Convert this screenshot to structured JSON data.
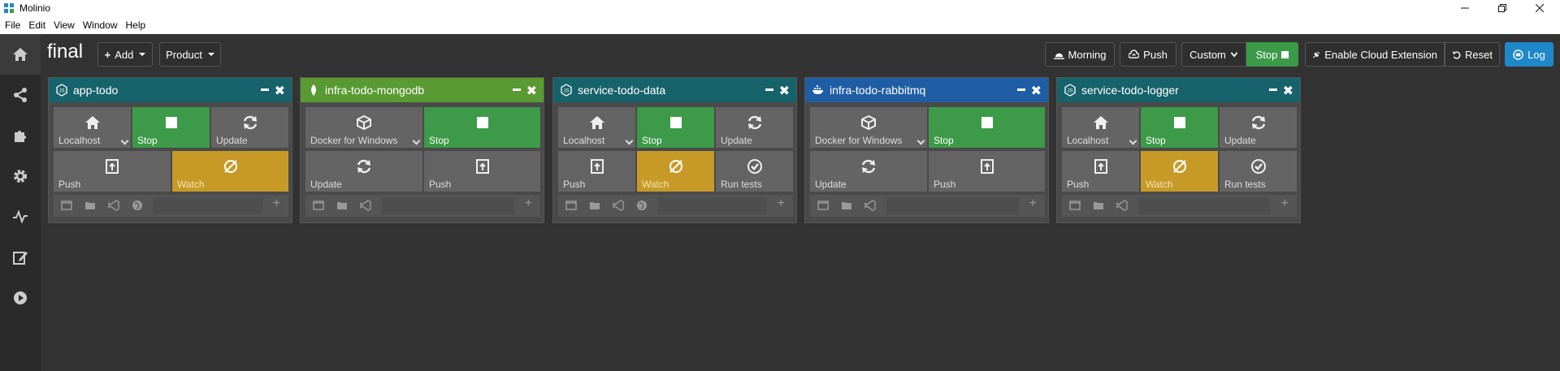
{
  "window": {
    "title": "Molinio"
  },
  "menu": {
    "items": [
      "File",
      "Edit",
      "View",
      "Window",
      "Help"
    ]
  },
  "toolbar": {
    "workspace_title": "final",
    "add_label": "Add",
    "product_label": "Product",
    "morning_label": "Morning",
    "push_label": "Push",
    "custom_label": "Custom",
    "stop_label": "Stop",
    "cloud_label": "Enable Cloud Extension",
    "reset_label": "Reset",
    "log_label": "Log"
  },
  "colors": {
    "teal_header": "#17636b",
    "green_header": "#5a9a32",
    "blue_header": "#1f5ea4",
    "green_tile": "#3d9a48",
    "yellow_tile": "#c79a28",
    "log_blue": "#1e88c8"
  },
  "services": [
    {
      "name": "app-todo",
      "header_icon": "hexagon-node-icon",
      "env": "Localhost",
      "row1": [
        "Localhost",
        "Stop",
        "Update"
      ],
      "row2": [
        "Push",
        "Watch"
      ]
    },
    {
      "name": "infra-todo-mongodb",
      "header_icon": "leaf-icon",
      "env": "Docker for Windows",
      "row1": [
        "Docker for Windows",
        "Stop"
      ],
      "row2": [
        "Update",
        "Push"
      ]
    },
    {
      "name": "service-todo-data",
      "header_icon": "hexagon-node-icon",
      "env": "Localhost",
      "row1": [
        "Localhost",
        "Stop",
        "Update"
      ],
      "row2": [
        "Push",
        "Watch",
        "Run tests"
      ]
    },
    {
      "name": "infra-todo-rabbitmq",
      "header_icon": "docker-whale-icon",
      "env": "Docker for Windows",
      "row1": [
        "Docker for Windows",
        "Stop"
      ],
      "row2": [
        "Update",
        "Push"
      ]
    },
    {
      "name": "service-todo-logger",
      "header_icon": "hexagon-node-icon",
      "env": "Localhost",
      "row1": [
        "Localhost",
        "Stop",
        "Update"
      ],
      "row2": [
        "Push",
        "Watch",
        "Run tests"
      ]
    }
  ],
  "footer_plus": "+"
}
